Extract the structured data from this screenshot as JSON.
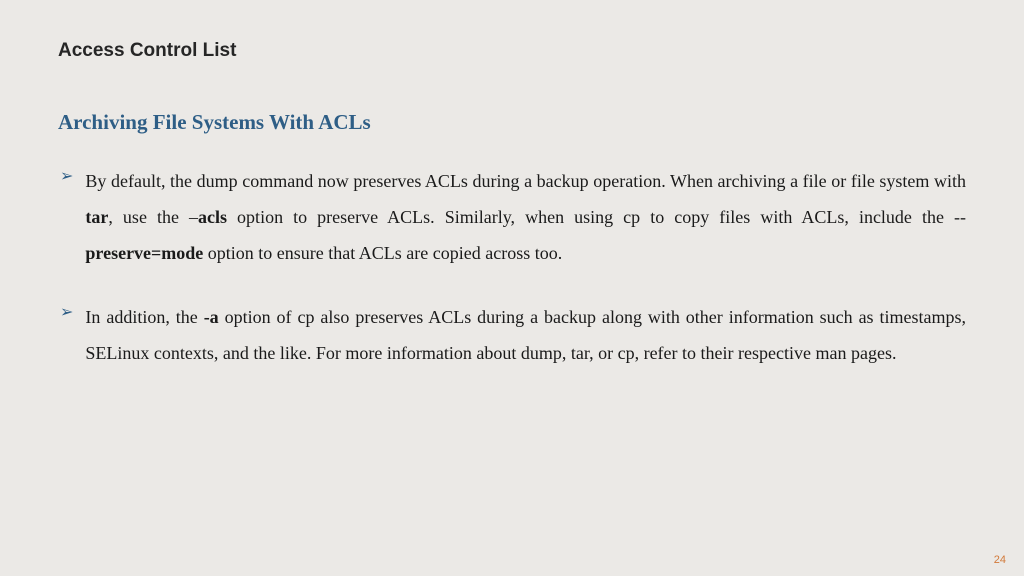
{
  "title": "Access Control List",
  "subtitle": "Archiving File Systems With ACLs",
  "bullets": [
    {
      "pre1": "By default, the dump command now preserves ACLs during a backup operation. When archiving a file or file system with ",
      "b1": "tar",
      "mid1": ", use the –",
      "b2": "acls",
      "mid2": " option to preserve ACLs. Similarly, when using cp to copy files with ACLs, include the --",
      "b3": "preserve=mode",
      "post": " option to ensure that ACLs are copied across too."
    },
    {
      "pre1": "In addition, the ",
      "b1": "-a",
      "mid1": " option of cp also preserves ACLs during a backup along with other information such as timestamps, SELinux contexts, and the like. For more information about dump, tar, or cp, refer to their respective man pages.",
      "b2": "",
      "mid2": "",
      "b3": "",
      "post": ""
    }
  ],
  "page_number": "24",
  "arrow_glyph": "➢"
}
